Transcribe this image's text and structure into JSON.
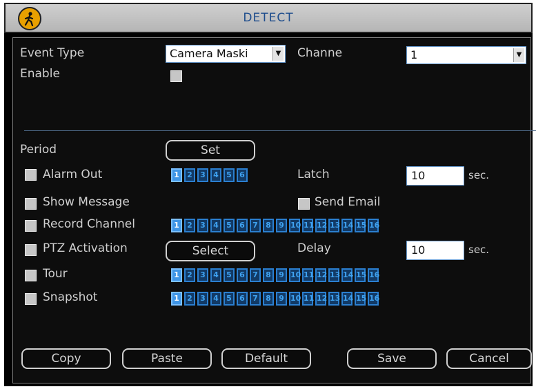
{
  "window": {
    "title": "DETECT",
    "icon": "motion-person-icon"
  },
  "event_type": {
    "label": "Event Type",
    "value": "Camera Maski"
  },
  "channel": {
    "label": "Channe",
    "value": "1"
  },
  "enable": {
    "label": "Enable",
    "checked": false
  },
  "period": {
    "label": "Period",
    "button": "Set"
  },
  "alarm_out": {
    "label": "Alarm Out",
    "checked": false,
    "outputs": [
      "1",
      "2",
      "3",
      "4",
      "5",
      "6"
    ],
    "selected": [
      "1"
    ]
  },
  "latch": {
    "label": "Latch",
    "value": "10",
    "unit": "sec."
  },
  "show_message": {
    "label": "Show Message",
    "checked": false
  },
  "send_email": {
    "label": "Send Email",
    "checked": false
  },
  "record_channel": {
    "label": "Record Channel",
    "checked": false,
    "channels": [
      "1",
      "2",
      "3",
      "4",
      "5",
      "6",
      "7",
      "8",
      "9",
      "10",
      "11",
      "12",
      "13",
      "14",
      "15",
      "16"
    ],
    "selected": [
      "1"
    ]
  },
  "ptz": {
    "label": "PTZ Activation",
    "button": "Select"
  },
  "delay": {
    "label": "Delay",
    "value": "10",
    "unit": "sec."
  },
  "tour": {
    "label": "Tour",
    "checked": false,
    "channels": [
      "1",
      "2",
      "3",
      "4",
      "5",
      "6",
      "7",
      "8",
      "9",
      "10",
      "11",
      "12",
      "13",
      "14",
      "15",
      "16"
    ],
    "selected": [
      "1"
    ]
  },
  "snapshot": {
    "label": "Snapshot",
    "checked": false,
    "channels": [
      "1",
      "2",
      "3",
      "4",
      "5",
      "6",
      "7",
      "8",
      "9",
      "10",
      "11",
      "12",
      "13",
      "14",
      "15",
      "16"
    ],
    "selected": [
      "1"
    ]
  },
  "buttons": {
    "copy": "Copy",
    "paste": "Paste",
    "default": "Default",
    "save": "Save",
    "cancel": "Cancel"
  },
  "colors": {
    "background": "#0d0d0d",
    "accent": "#3f95e6",
    "title_text": "#1d4c8c",
    "label_text": "#cfcfcf"
  }
}
